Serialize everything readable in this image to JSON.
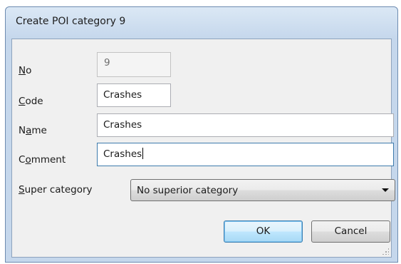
{
  "window": {
    "title": "Create POI category 9"
  },
  "form": {
    "no": {
      "label_mnemonic": "N",
      "label_rest": "o",
      "value": "9"
    },
    "code": {
      "label_mnemonic": "C",
      "label_rest": "ode",
      "value": "Crashes"
    },
    "name": {
      "label_pre": "N",
      "label_mnemonic": "a",
      "label_rest": "me",
      "value": "Crashes"
    },
    "comment": {
      "label_pre": "C",
      "label_mnemonic": "o",
      "label_rest": "mment",
      "value": "Crashes"
    },
    "super_category": {
      "label_mnemonic": "S",
      "label_rest": "uper category",
      "selected": "No superior category"
    }
  },
  "buttons": {
    "ok": "OK",
    "cancel": "Cancel"
  },
  "icons": {
    "dropdown": "chevron-down-icon",
    "resize": "resize-grip-icon"
  }
}
